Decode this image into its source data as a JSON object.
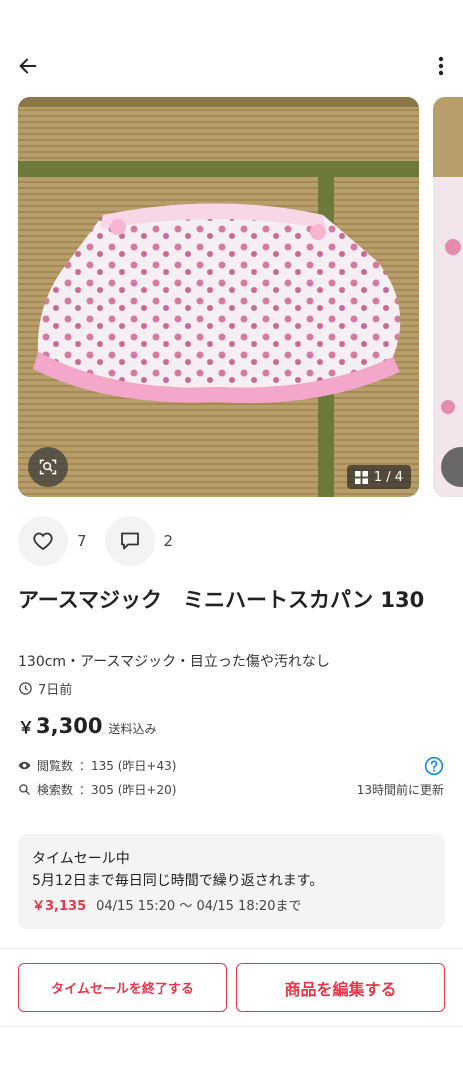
{
  "header": {
    "back_icon": "arrow-left-icon",
    "more_icon": "more-vertical-icon"
  },
  "gallery": {
    "counter": "1 / 4",
    "zoom_icon": "image-search-icon",
    "grid_icon": "grid-icon"
  },
  "actions": {
    "like_count": "7",
    "comment_count": "2"
  },
  "product": {
    "title": "アースマジック　ミニハートスカパン 130",
    "subtitle": "130cm・アースマジック・目立った傷や汚れなし",
    "posted": "7日前",
    "price_symbol": "￥",
    "price": "3,300",
    "shipping": "送料込み"
  },
  "stats": {
    "views_label": "閲覧数",
    "views_value": "：135 (昨日+43)",
    "searches_label": "検索数",
    "searches_value": "：305 (昨日+20)",
    "updated": "13時間前に更新"
  },
  "sale": {
    "title": "タイムセール中",
    "description": "5月12日まで毎日同じ時間で繰り返されます。",
    "price": "￥3,135",
    "period": "04/15 15:20 〜 04/15 18:20まで"
  },
  "buttons": {
    "end_sale": "タイムセールを終了する",
    "edit": "商品を編集する"
  },
  "colors": {
    "accent": "#e4384b",
    "help": "#1a8cd8"
  }
}
